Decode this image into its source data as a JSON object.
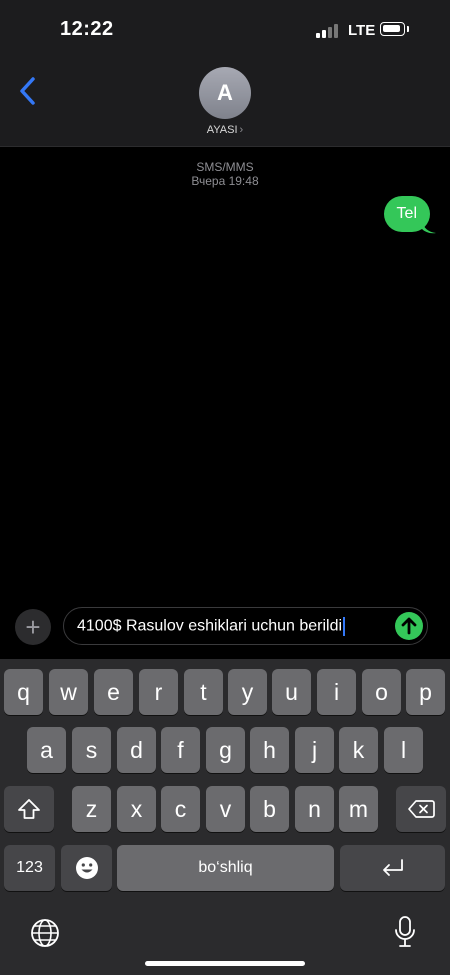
{
  "status": {
    "time": "12:22",
    "network": "LTE"
  },
  "header": {
    "avatar_initial": "A",
    "contact_name": "AYASI",
    "chevron": "›"
  },
  "thread": {
    "service": "SMS/MMS",
    "timestamp": "Вчера 19:48",
    "messages": [
      {
        "text": "Tel",
        "direction": "outgoing",
        "color": "#34c759"
      }
    ]
  },
  "composer": {
    "plus": "+",
    "text": "4100$ Rasulov eshiklari uchun berildi"
  },
  "keyboard": {
    "row1": [
      "q",
      "w",
      "e",
      "r",
      "t",
      "y",
      "u",
      "i",
      "o",
      "p"
    ],
    "row2": [
      "a",
      "s",
      "d",
      "f",
      "g",
      "h",
      "j",
      "k",
      "l"
    ],
    "row3": [
      "z",
      "x",
      "c",
      "v",
      "b",
      "n",
      "m"
    ],
    "numbers": "123",
    "space": "bo‘shliq",
    "shift_icon": "shift-icon",
    "delete_icon": "delete-icon",
    "return_icon": "return-icon",
    "emoji_icon": "emoji-icon",
    "globe_icon": "globe-icon",
    "mic_icon": "microphone-icon"
  },
  "colors": {
    "accent_blue": "#3478f6",
    "imessage_green": "#34c759",
    "key": "#6b6b6e",
    "key_dark": "#464649"
  }
}
